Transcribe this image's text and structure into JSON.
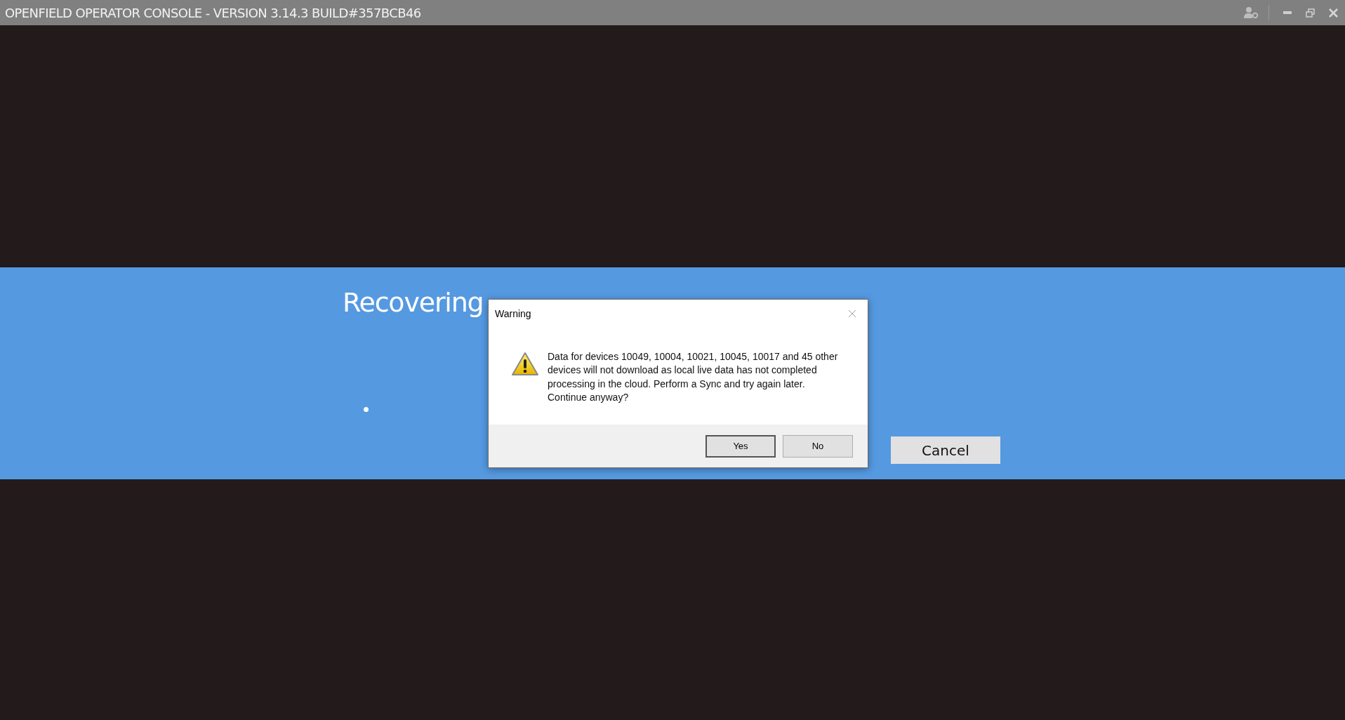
{
  "window": {
    "title": "OPENFIELD OPERATOR CONSOLE - VERSION 3.14.3 BUILD#357BCB46"
  },
  "progress": {
    "heading": "Recovering",
    "cancel_button": "Cancel"
  },
  "dialog": {
    "title": "Warning",
    "message": "Data for devices 10049, 10004, 10021, 10045, 10017 and 45 other devices will not download as local live data has not completed processing in the cloud. Perform a Sync and try again later. Continue anyway?",
    "buttons": [
      {
        "label": "Yes",
        "selected": true
      },
      {
        "label": "No",
        "selected": false
      }
    ]
  }
}
